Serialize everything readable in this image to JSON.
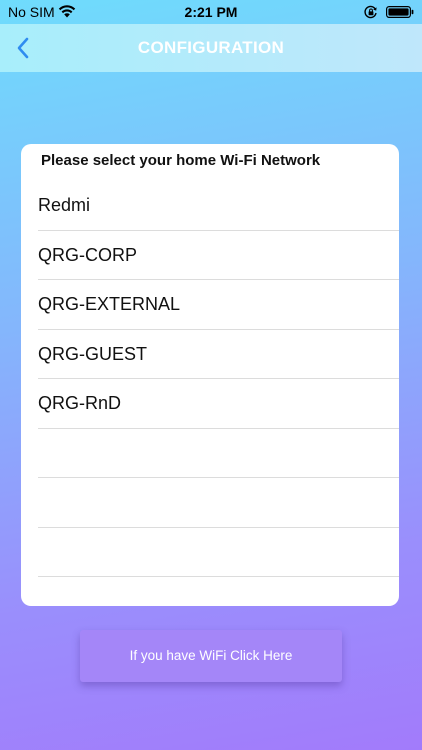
{
  "status_bar": {
    "carrier": "No SIM",
    "time": "2:21 PM",
    "icons": [
      "wifi-icon",
      "orientation-lock-icon",
      "battery-icon"
    ]
  },
  "nav": {
    "title": "CONFIGURATION",
    "back_icon": "chevron-left-icon",
    "accent_color": "#2f8cf0"
  },
  "card": {
    "header": "Please select your home Wi-Fi Network",
    "networks": [
      {
        "name": "Redmi"
      },
      {
        "name": "QRG-CORP"
      },
      {
        "name": "QRG-EXTERNAL"
      },
      {
        "name": "QRG-GUEST"
      },
      {
        "name": "QRG-RnD"
      },
      {
        "name": ""
      },
      {
        "name": ""
      },
      {
        "name": ""
      },
      {
        "name": ""
      }
    ]
  },
  "footer": {
    "button_label": "If you have WiFi Click Here",
    "button_color": "#a486f8"
  }
}
